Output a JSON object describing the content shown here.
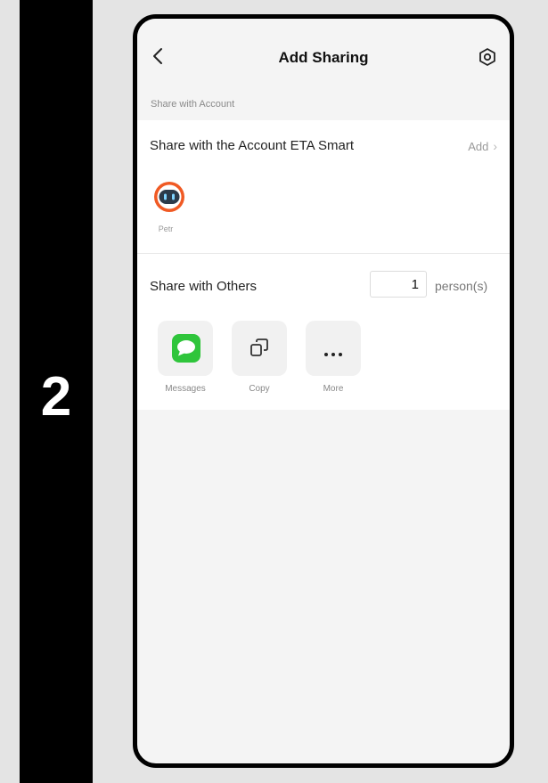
{
  "step": {
    "number": "2"
  },
  "header": {
    "title": "Add Sharing",
    "back_icon": "chevron-left-icon",
    "settings_icon": "settings-icon"
  },
  "account_section": {
    "label": "Share with Account",
    "title": "Share with the Account ETA Smart",
    "add_label": "Add",
    "chevron_icon": "chevron-right-icon",
    "users": [
      {
        "name": "Petr",
        "avatar_icon": "robot-avatar-icon"
      }
    ]
  },
  "others_section": {
    "title": "Share with Others",
    "count_value": "1",
    "count_unit": "person(s)",
    "share_options": [
      {
        "label": "Messages",
        "icon": "messages-icon"
      },
      {
        "label": "Copy",
        "icon": "copy-icon"
      },
      {
        "label": "More",
        "icon": "more-icon"
      }
    ]
  },
  "colors": {
    "messages_green": "#2fc53b",
    "avatar_orange": "#f05a24",
    "background": "#f4f4f4"
  }
}
